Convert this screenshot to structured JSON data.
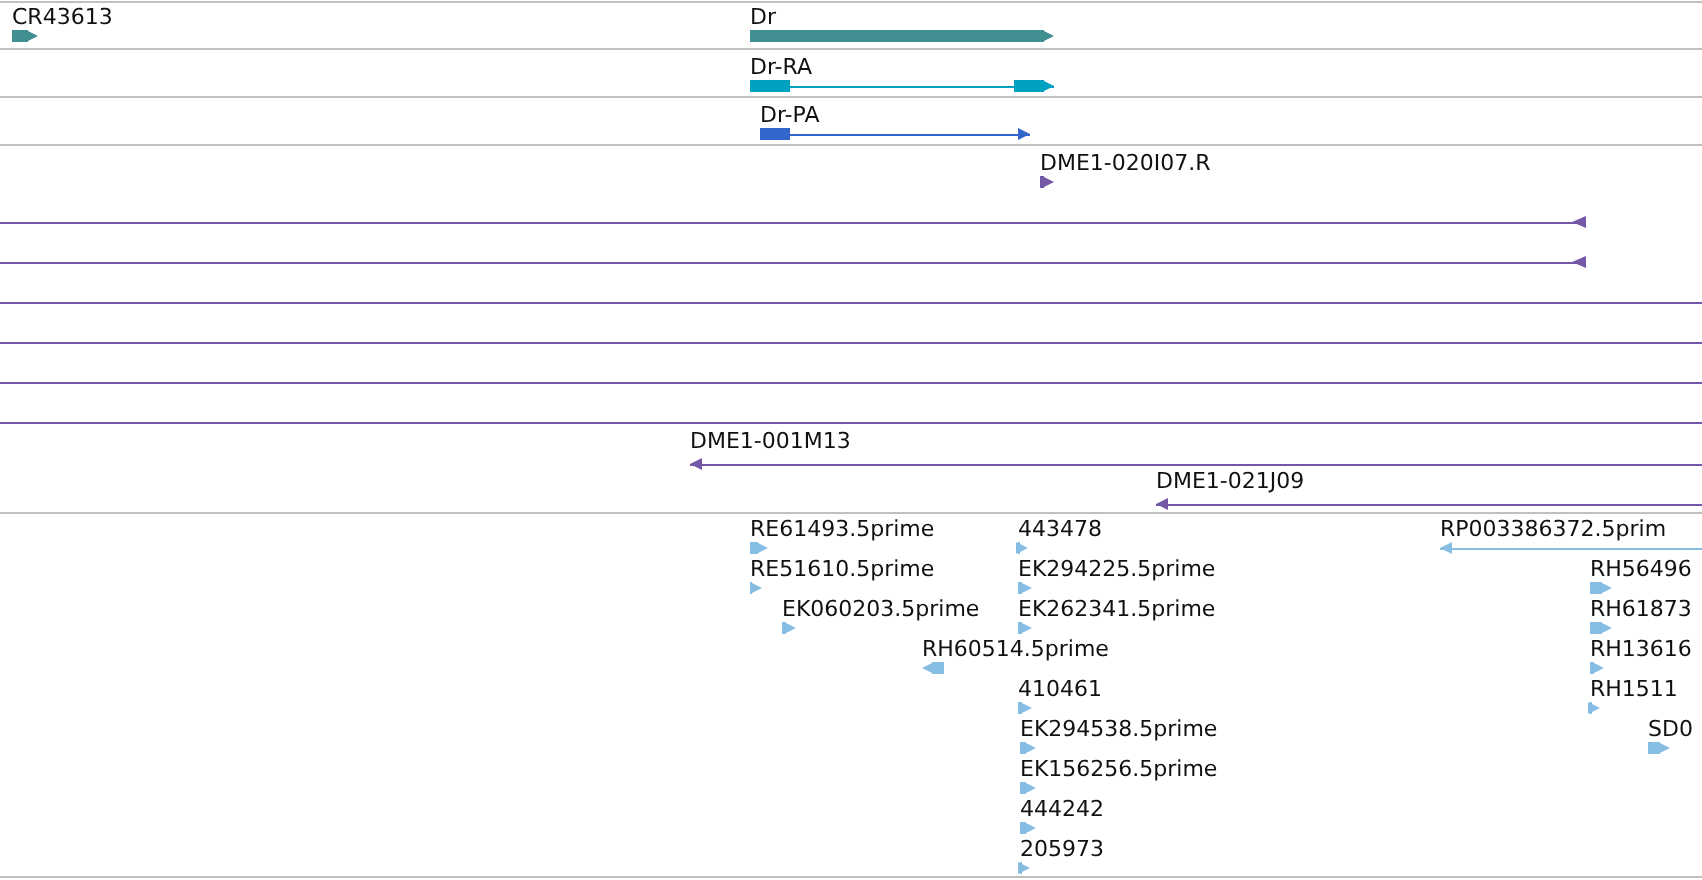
{
  "tracks": [
    {
      "kind": "gene",
      "features": [
        {
          "label": "CR43613",
          "reverse": false
        },
        {
          "label": "Dr",
          "reverse": false
        }
      ]
    },
    {
      "kind": "transcript",
      "features": [
        {
          "label": "Dr-RA",
          "reverse": false,
          "color": "#00a0c0"
        }
      ]
    },
    {
      "kind": "transcript",
      "features": [
        {
          "label": "Dr-PA",
          "reverse": false,
          "color": "#3366cc"
        }
      ]
    },
    {
      "kind": "clone",
      "features": [
        {
          "label": "DME1-020I07.R",
          "reverse": false
        },
        {
          "reverse": true
        },
        {
          "reverse": true
        },
        {
          "kind": "span"
        },
        {
          "kind": "span"
        },
        {
          "kind": "span"
        },
        {
          "kind": "span"
        },
        {
          "label": "DME1-001M13",
          "reverse": true
        },
        {
          "label": "DME1-021J09",
          "reverse": true
        }
      ]
    },
    {
      "kind": "est",
      "features": [
        {
          "label": "RE61493.5prime",
          "reverse": false
        },
        {
          "label": "443478",
          "reverse": false
        },
        {
          "label": "RP003386372.5prim",
          "reverse": true
        },
        {
          "label": "RE51610.5prime",
          "reverse": false
        },
        {
          "label": "EK294225.5prime",
          "reverse": false
        },
        {
          "label": "RH56496",
          "reverse": false
        },
        {
          "label": "EK060203.5prime",
          "reverse": false
        },
        {
          "label": "EK262341.5prime",
          "reverse": false
        },
        {
          "label": "RH61873",
          "reverse": false
        },
        {
          "label": "RH60514.5prime",
          "reverse": true
        },
        {
          "label": "RH13616",
          "reverse": false
        },
        {
          "label": "410461",
          "reverse": false
        },
        {
          "label": "RH1511",
          "reverse": false
        },
        {
          "label": "EK294538.5prime",
          "reverse": false
        },
        {
          "label": "SD0",
          "reverse": false
        },
        {
          "label": "EK156256.5prime",
          "reverse": false
        },
        {
          "label": "444242",
          "reverse": false
        },
        {
          "label": "205973",
          "reverse": false
        }
      ]
    }
  ]
}
